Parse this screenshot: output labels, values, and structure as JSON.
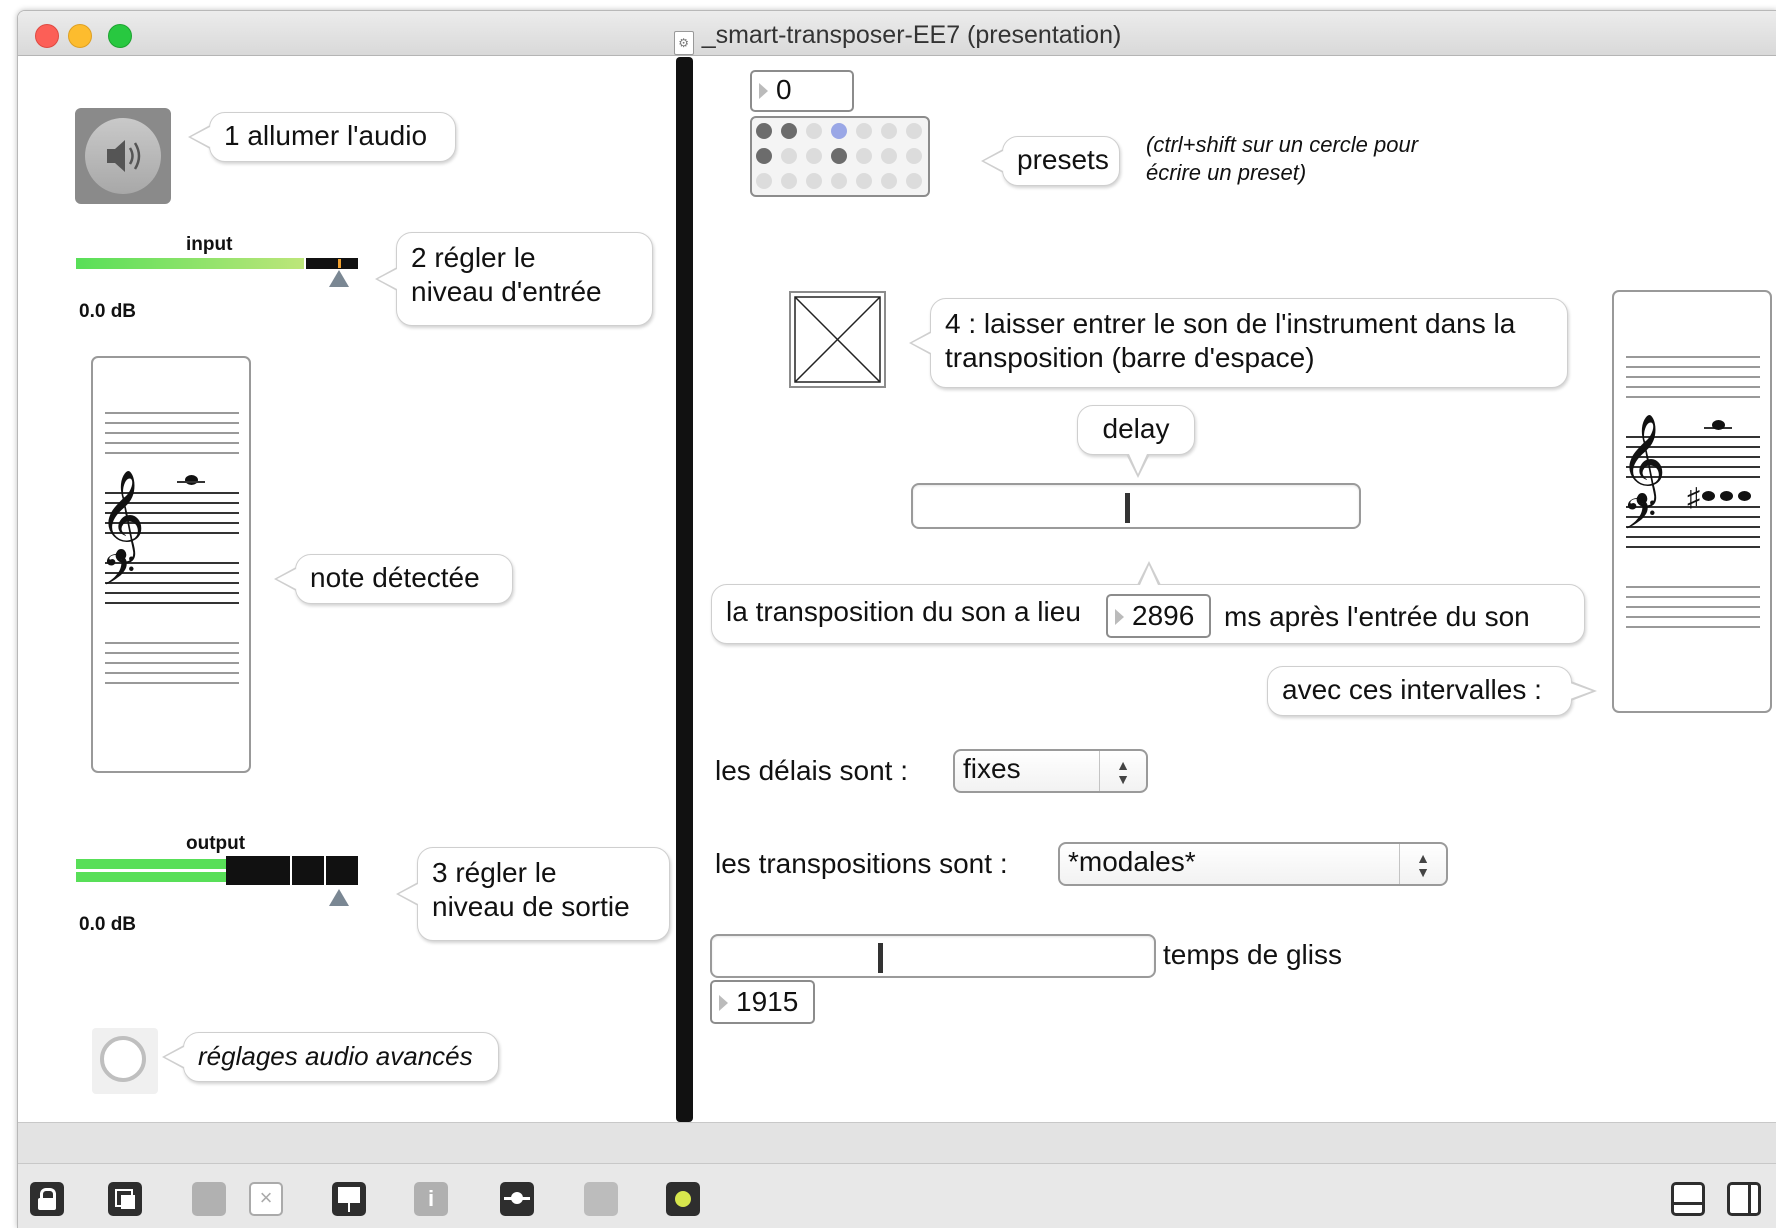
{
  "window": {
    "title": "_smart-transposer-EE7 (presentation)"
  },
  "left_panel": {
    "audio_label": "1 allumer l'audio",
    "input_meter": {
      "label": "input",
      "db": "0.0 dB"
    },
    "input_hint": [
      "2 régler le",
      "niveau d'entrée"
    ],
    "note_label": "note détectée",
    "output_meter": {
      "label": "output",
      "db": "0.0 dB"
    },
    "output_hint": [
      "3 régler le",
      "niveau de sortie"
    ],
    "advanced_label": "réglages audio avancés"
  },
  "right_panel": {
    "preset_number": "0",
    "presets_label": "presets",
    "presets_hint": [
      "(ctrl+shift sur un cercle pour",
      "écrire un preset)"
    ],
    "step4_label": [
      "4 : laisser entrer le son de l'instrument dans la",
      "transposition (barre d'espace)"
    ],
    "delay_label": "delay",
    "delay_slider": {
      "value": 0.48
    },
    "transpo_sentence": {
      "before": "la transposition du son a lieu",
      "value": "2896",
      "after": "ms après l'entrée du son"
    },
    "intervals_label": "avec ces intervalles :",
    "delais_label": "les délais sont :",
    "delais_value": "fixes",
    "transpositions_label": "les transpositions sont :",
    "transpositions_value": "*modales*",
    "gliss_slider": {
      "value": 0.38
    },
    "gliss_label": "temps de gliss",
    "gliss_value": "1915"
  },
  "toolbar": {
    "icons": [
      "lock-icon",
      "new-object-icon",
      "palette-icon",
      "delete-icon",
      "presentation-icon",
      "info-icon",
      "patch-cord-icon",
      "grid-icon",
      "debug-icon",
      "split-view-icon",
      "single-view-icon"
    ]
  },
  "colors": {
    "meter_green": "#5fdd5f",
    "title_bar": "#e4e4e4",
    "preset_active": "#9aa7e6"
  }
}
